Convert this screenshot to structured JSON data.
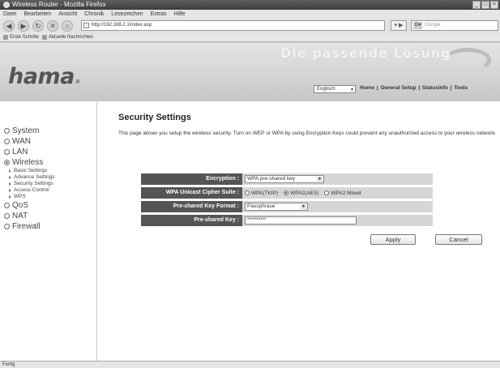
{
  "window": {
    "title": "Wireless Router - Mozilla Firefox"
  },
  "menubar": [
    "Datei",
    "Bearbeiten",
    "Ansicht",
    "Chronik",
    "Lesezeichen",
    "Extras",
    "Hilfe"
  ],
  "navbar": {
    "url": "http://192.168.2.1/index.asp",
    "search_placeholder": "Google"
  },
  "bookmarks": [
    "Erste Schritte",
    "Aktuelle Nachrichten"
  ],
  "header": {
    "logo": "hama",
    "tagline": "Die passende Lösung",
    "language": "Englisch",
    "nav": [
      "Home",
      "General Setup",
      "Statusinfo",
      "Tools"
    ]
  },
  "sidebar": {
    "items": [
      {
        "label": "System"
      },
      {
        "label": "WAN"
      },
      {
        "label": "LAN"
      },
      {
        "label": "Wireless",
        "active": true,
        "sub": [
          "Basic Settings",
          "Advance Settings",
          "Security Settings",
          "Access Control",
          "WPS"
        ]
      },
      {
        "label": "QoS"
      },
      {
        "label": "NAT"
      },
      {
        "label": "Firewall"
      }
    ]
  },
  "main": {
    "title": "Security Settings",
    "description": "This page allows you setup the wireless security. Turn on WEP or WPA by using Encryption Keys could prevent any unauthorized access to your wireless network.",
    "encryption": {
      "label": "Encryption :",
      "value": "WPA pre-shared key"
    },
    "cipher": {
      "label": "WPA Unicast Cipher Suite :",
      "options": [
        "WPA(TKIP)",
        "WPA2(AES)",
        "WPA2 Mixed"
      ],
      "selected": "WPA2(AES)"
    },
    "key_format": {
      "label": "Pre-shared Key Format :",
      "value": "Passphrase"
    },
    "key": {
      "label": "Pre-shared Key :",
      "value": "**********"
    },
    "apply_label": "Apply",
    "cancel_label": "Cancel"
  },
  "status": "Fertig"
}
